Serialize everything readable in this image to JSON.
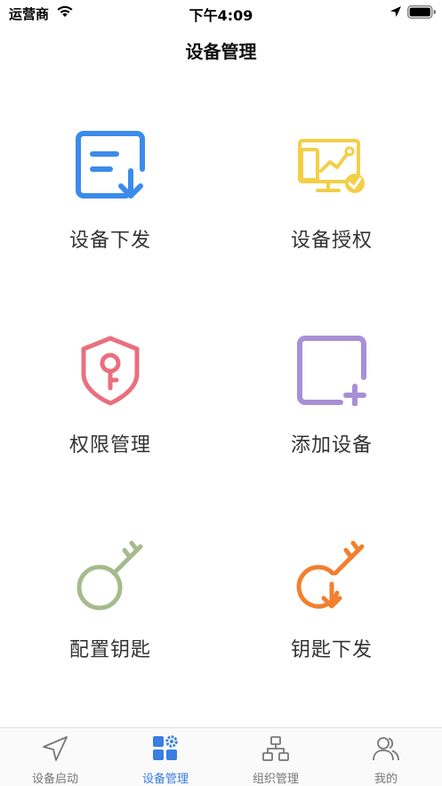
{
  "status_bar": {
    "carrier": "运营商",
    "time": "下午4:09"
  },
  "nav": {
    "title": "设备管理"
  },
  "grid": {
    "items": [
      {
        "label": "设备下发",
        "icon": "device-dispatch-icon",
        "color": "#3b8beb"
      },
      {
        "label": "设备授权",
        "icon": "device-authorize-icon",
        "color": "#f3cf46"
      },
      {
        "label": "权限管理",
        "icon": "permission-shield-key-icon",
        "color": "#ea6f7f"
      },
      {
        "label": "添加设备",
        "icon": "add-device-icon",
        "color": "#a98fd6"
      },
      {
        "label": "配置钥匙",
        "icon": "configure-key-icon",
        "color": "#a6bb8c"
      },
      {
        "label": "钥匙下发",
        "icon": "key-dispatch-icon",
        "color": "#f2802e"
      }
    ]
  },
  "tab_bar": {
    "active_index": 1,
    "active_color": "#3a7ee0",
    "tabs": [
      {
        "label": "设备启动",
        "icon": "navigation-arrow-icon"
      },
      {
        "label": "设备管理",
        "icon": "grid-gear-icon"
      },
      {
        "label": "组织管理",
        "icon": "org-chart-icon"
      },
      {
        "label": "我的",
        "icon": "users-icon"
      }
    ]
  }
}
